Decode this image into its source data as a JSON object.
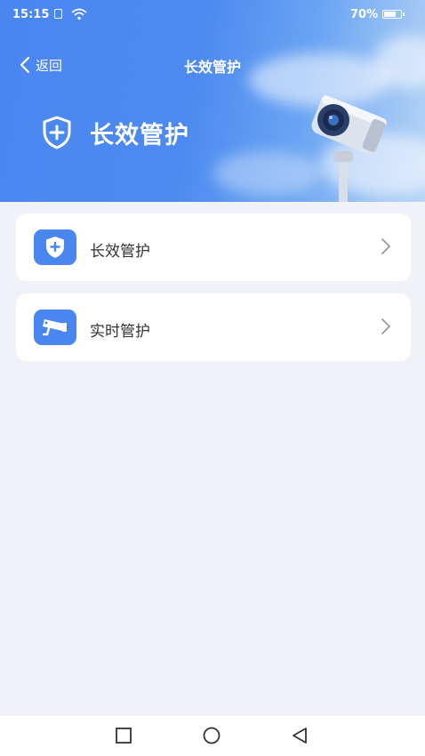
{
  "status_bar": {
    "time": "15:15",
    "battery": "70%"
  },
  "nav": {
    "back_label": "返回",
    "title": "长效管护"
  },
  "banner": {
    "title": "长效管护"
  },
  "menu": {
    "items": [
      {
        "label": "长效管护",
        "icon": "shield-plus-icon"
      },
      {
        "label": "实时管护",
        "icon": "camera-icon"
      }
    ]
  },
  "colors": {
    "accent": "#4a86f0",
    "background": "#f1f2f7"
  }
}
